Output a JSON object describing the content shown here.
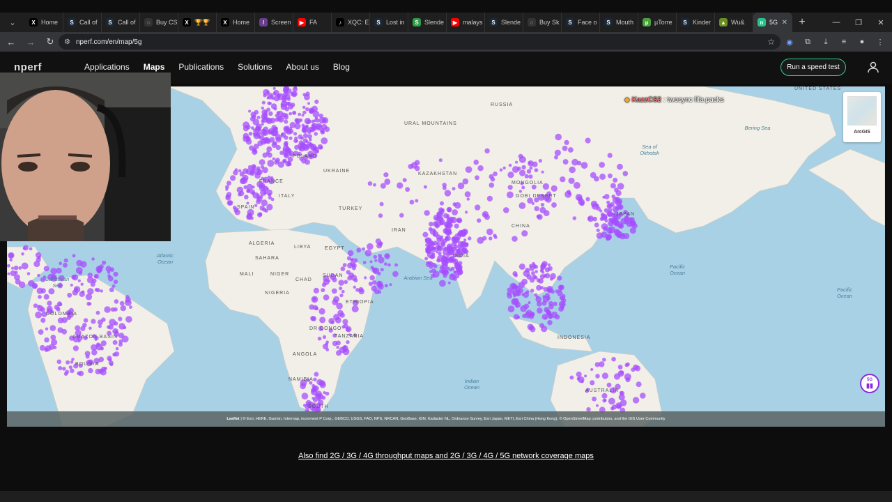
{
  "browser": {
    "tabs": [
      {
        "label": "Home",
        "fav_color": "#000",
        "fav_char": "X"
      },
      {
        "label": "Call of",
        "fav_color": "#1b2838",
        "fav_char": "S"
      },
      {
        "label": "Call of",
        "fav_color": "#1b2838",
        "fav_char": "S"
      },
      {
        "label": "Buy CS",
        "fav_color": "#333",
        "fav_char": "◌"
      },
      {
        "label": "🏆🏆",
        "fav_color": "#000",
        "fav_char": "X"
      },
      {
        "label": "Home",
        "fav_color": "#000",
        "fav_char": "X"
      },
      {
        "label": "Screen",
        "fav_color": "#6a3e8f",
        "fav_char": "/"
      },
      {
        "label": "FA",
        "fav_color": "#ff0000",
        "fav_char": "▶"
      },
      {
        "label": "XQC: E",
        "fav_color": "#000",
        "fav_char": "♪"
      },
      {
        "label": "Lost in",
        "fav_color": "#1b2838",
        "fav_char": "S"
      },
      {
        "label": "Slende",
        "fav_color": "#2e9b48",
        "fav_char": "S"
      },
      {
        "label": "malays",
        "fav_color": "#ff0000",
        "fav_char": "▶"
      },
      {
        "label": "Slende",
        "fav_color": "#1b2838",
        "fav_char": "S"
      },
      {
        "label": "Buy Sk",
        "fav_color": "#333",
        "fav_char": "◌"
      },
      {
        "label": "Face o",
        "fav_color": "#1b2838",
        "fav_char": "S"
      },
      {
        "label": "Mouth",
        "fav_color": "#1b2838",
        "fav_char": "S"
      },
      {
        "label": "µTorre",
        "fav_color": "#4aa13d",
        "fav_char": "µ"
      },
      {
        "label": "Kinder",
        "fav_color": "#1b2838",
        "fav_char": "S"
      },
      {
        "label": "Wu&",
        "fav_color": "#6b8e23",
        "fav_char": "▲"
      },
      {
        "label": "5G",
        "fav_color": "#22c48a",
        "fav_char": "n"
      }
    ],
    "new_tab": "+",
    "url": "nperf.com/en/map/5g"
  },
  "site": {
    "logo": "nperf",
    "nav": [
      {
        "label": "Applications",
        "active": false
      },
      {
        "label": "Maps",
        "active": true
      },
      {
        "label": "Publications",
        "active": false
      },
      {
        "label": "Solutions",
        "active": false
      },
      {
        "label": "About us",
        "active": false
      },
      {
        "label": "Blog",
        "active": false
      }
    ],
    "speed_test": "Run a speed test"
  },
  "map": {
    "accent_color": "#a64dff",
    "regions": [
      "RUSSIA",
      "KAZAKHSTAN",
      "MONGOLIA",
      "GOBI DESERT",
      "CHINA",
      "INDIA",
      "IRAN",
      "TURKEY",
      "UKRAINE",
      "POLAND",
      "FRANCE",
      "SPAIN",
      "ITALY",
      "ALGERIA",
      "LIBYA",
      "EGYPT",
      "SAHARA",
      "MALI",
      "NIGER",
      "CHAD",
      "SUDAN",
      "NIGERIA",
      "ETHIOPIA",
      "DR CONGO",
      "TANZANIA",
      "ANGOLA",
      "NAMIBIA",
      "SOUTH",
      "INDONESIA",
      "AUSTRALIA",
      "JAPAN",
      "COLOMBIA",
      "AMAZON BASIN",
      "BOLIVIA",
      "UNITED STATES",
      "URAL MOUNTAINS"
    ],
    "oceans": [
      {
        "name": "Atlantic Ocean"
      },
      {
        "name": "Pacific Ocean"
      },
      {
        "name": "Pacific Ocean"
      },
      {
        "name": "Indian Ocean"
      },
      {
        "name": "Arabian Sea"
      },
      {
        "name": "Bering Sea"
      },
      {
        "name": "Sea of Okhotsk"
      },
      {
        "name": "Caribbean Sea"
      }
    ],
    "chat": {
      "user": "KazzCS2",
      "message": ": twosync fifa packs"
    },
    "basemap_label": "ArcGIS",
    "badge": "5G",
    "attribution_leaflet": "Leaflet",
    "attribution_text": "| © Esri, HERE, Garmin, Intermap, increment P Corp., GEBCO, USGS, FAO, NPS, NRCAN, GeoBase, IGN, Kadaster NL, Ordnance Survey, Esri Japan, METI, Esri China (Hong Kong), © OpenStreetMap contributors, and the GIS User Community"
  },
  "footer": {
    "coverage_link": "Also find 2G / 3G / 4G throughput maps and 2G / 3G / 4G / 5G network coverage maps"
  }
}
